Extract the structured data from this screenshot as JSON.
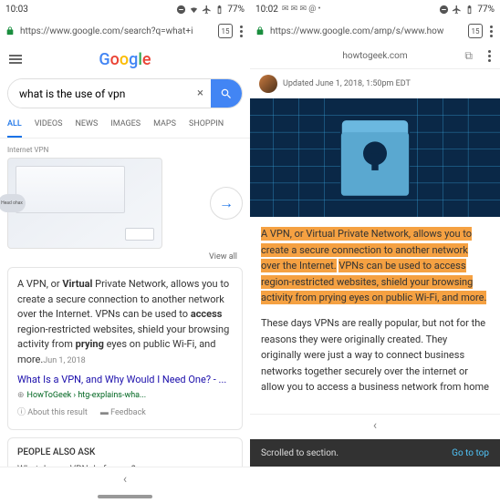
{
  "left": {
    "time": "10:03",
    "battery": "77%",
    "tabcount": "15",
    "url": "https://www.google.com/search?q=what+i",
    "logo": [
      "G",
      "o",
      "o",
      "g",
      "l",
      "e"
    ],
    "logoColors": [
      "#4285f4",
      "#ea4335",
      "#fbbc05",
      "#4285f4",
      "#34a853",
      "#ea4335"
    ],
    "query": "what is the use of vpn",
    "tabs": [
      "ALL",
      "VIDEOS",
      "NEWS",
      "IMAGES",
      "MAPS",
      "SHOPPIN"
    ],
    "internetLabel": "Internet VPN",
    "cloudLabel": "Head ohax",
    "viewAll": "View all",
    "snippet": {
      "p1": "A VPN, or ",
      "b1": "Virtual",
      "p2": " Private Network, allows you to create a secure connection to another network over the Internet. VPNs can be used to ",
      "b2": "access",
      "p3": " region-restricted websites, shield your browsing activity from ",
      "b3": "prying",
      "p4": " eyes on public Wi-Fi, and more.",
      "date": "Jun 1, 2018"
    },
    "resultTitle": "What Is a VPN, and Why Would I Need One? - ...",
    "resultCite": "HowToGeek › htg-explains-wha...",
    "about": "About this result",
    "feedback": "Feedback",
    "paa": "PEOPLE ALSO ASK",
    "paaQ": "What does a VPN do for you?"
  },
  "right": {
    "time": "10:02",
    "battery": "77%",
    "tabcount": "15",
    "url": "https://www.google.com/amp/s/www.how",
    "site": "howtogeek.com",
    "byline": "Updated June 1, 2018, 1:50pm EDT",
    "hl1": "A VPN, or Virtual Private Network, allows you to create a secure connection to another network over the Internet.",
    "hl2": "VPNs can be used to access region-restricted websites, shield your browsing activity from prying eyes on public Wi-Fi, and more.",
    "para2": "These days VPNs are really popular, but not for the reasons they were originally created. They originally were just a way to connect business networks together securely over the internet or allow you to access a business network from home",
    "toast": "Scrolled to section.",
    "toastAction": "Go to top"
  }
}
